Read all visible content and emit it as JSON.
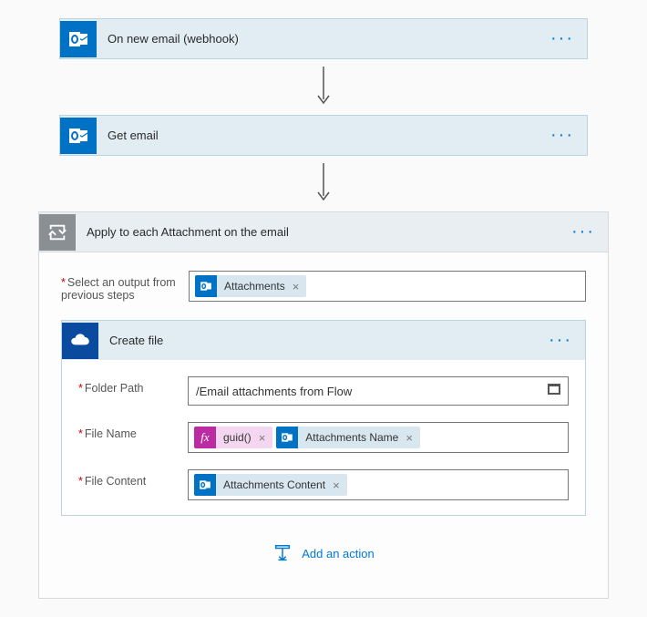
{
  "step1": {
    "title": "On new email (webhook)"
  },
  "step2": {
    "title": "Get email"
  },
  "loop": {
    "title": "Apply to each Attachment on the email",
    "input_label": "Select an output from previous steps",
    "input_token": "Attachments",
    "inner": {
      "title": "Create file",
      "fields": {
        "folder_label": "Folder Path",
        "folder_value": "/Email attachments from Flow",
        "name_label": "File Name",
        "name_tokens": {
          "fx": "guid()",
          "dyn": "Attachments Name"
        },
        "content_label": "File Content",
        "content_token": "Attachments Content"
      }
    },
    "add_action": "Add an action"
  }
}
